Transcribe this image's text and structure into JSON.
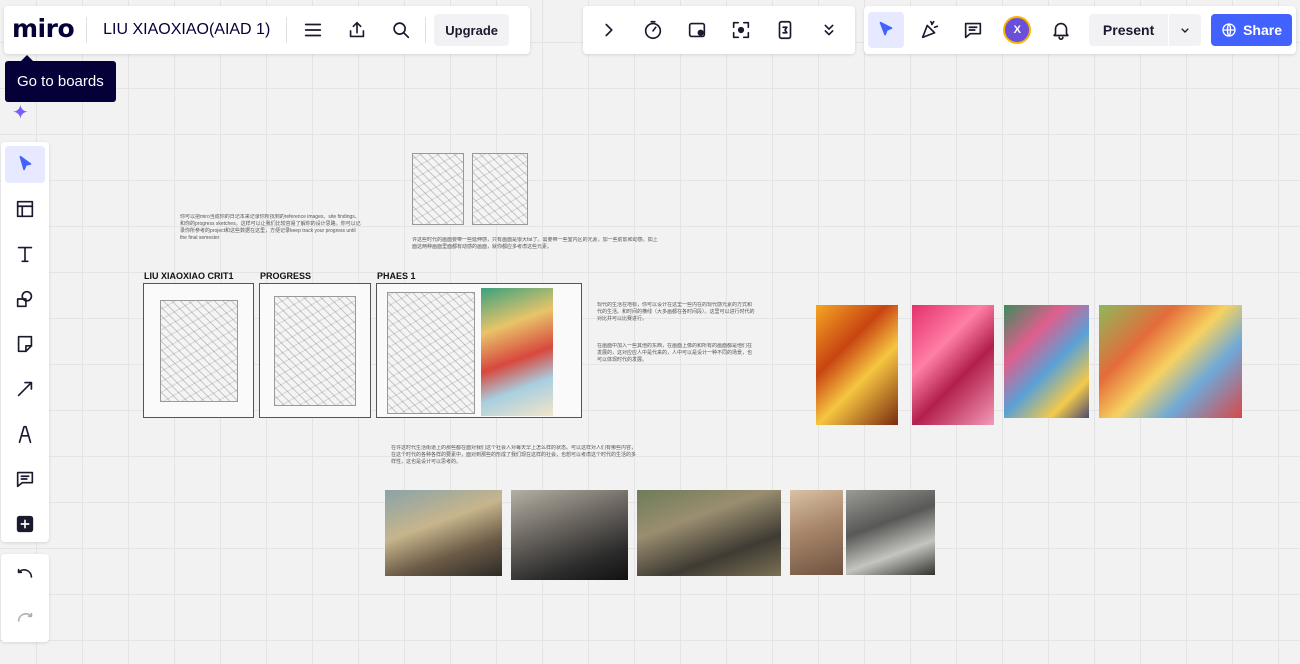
{
  "app": {
    "logo": "miro",
    "board_title": "LIU XIAOXIAO(AIAD 1)"
  },
  "toolbar": {
    "upgrade_label": "Upgrade",
    "present_label": "Present",
    "share_label": "Share",
    "avatar_initial": "X"
  },
  "tooltip": {
    "text": "Go to boards"
  },
  "colors": {
    "accent": "#4262ff",
    "avatar": "#6a4fd8",
    "tooltip_bg": "#050038"
  },
  "canvas": {
    "frames": [
      {
        "label": "LIU XIAOXIAO CRIT1"
      },
      {
        "label": "PROGRESS"
      },
      {
        "label": "PHAES 1"
      }
    ],
    "notes": {
      "note1": "你可以把miro当成你的日记本来记录你所找到的reference images、site findings、和你的progress sketches。这样可以让我们比较容易了解你的设计思路。你可以记录你所参考的project和这些数据在这里，方便记录keep track your progress until the final semester",
      "note2": "许这些时代的画面要带一些延伸感，只有画面是很大fat了。需要带一些室内区的元素，加一些前影和动感。如上面这两种画面里面都有动感的画面，就你都应多考虑这些元素。",
      "note3": "现代的生活在地标，你可以设计在这里一些内在的现代感元素的方式和代的生活。和时间的横线（大多画都在各时间段）。这里可以进行时代的对比并可以比赛进行。",
      "note4": "在画面中加入一些其他的东西，在画面上像的和所有的画面都是他们在发展的，这对应应人中是代来的，人中可以是设计一种不同的场景，也可以体现时代的发展。",
      "note5": "在许这时代生活街道上的那些都在面对我们这个社会人对每天早上怎么样的状态。可以这样对人们有哪些内容，在这个时代的各种各样的要素中，面对到那些的形成了我们现在这样的社会，也想可以考虑这个时代的生活的多样性，这也是设计可以思考的。"
    }
  }
}
